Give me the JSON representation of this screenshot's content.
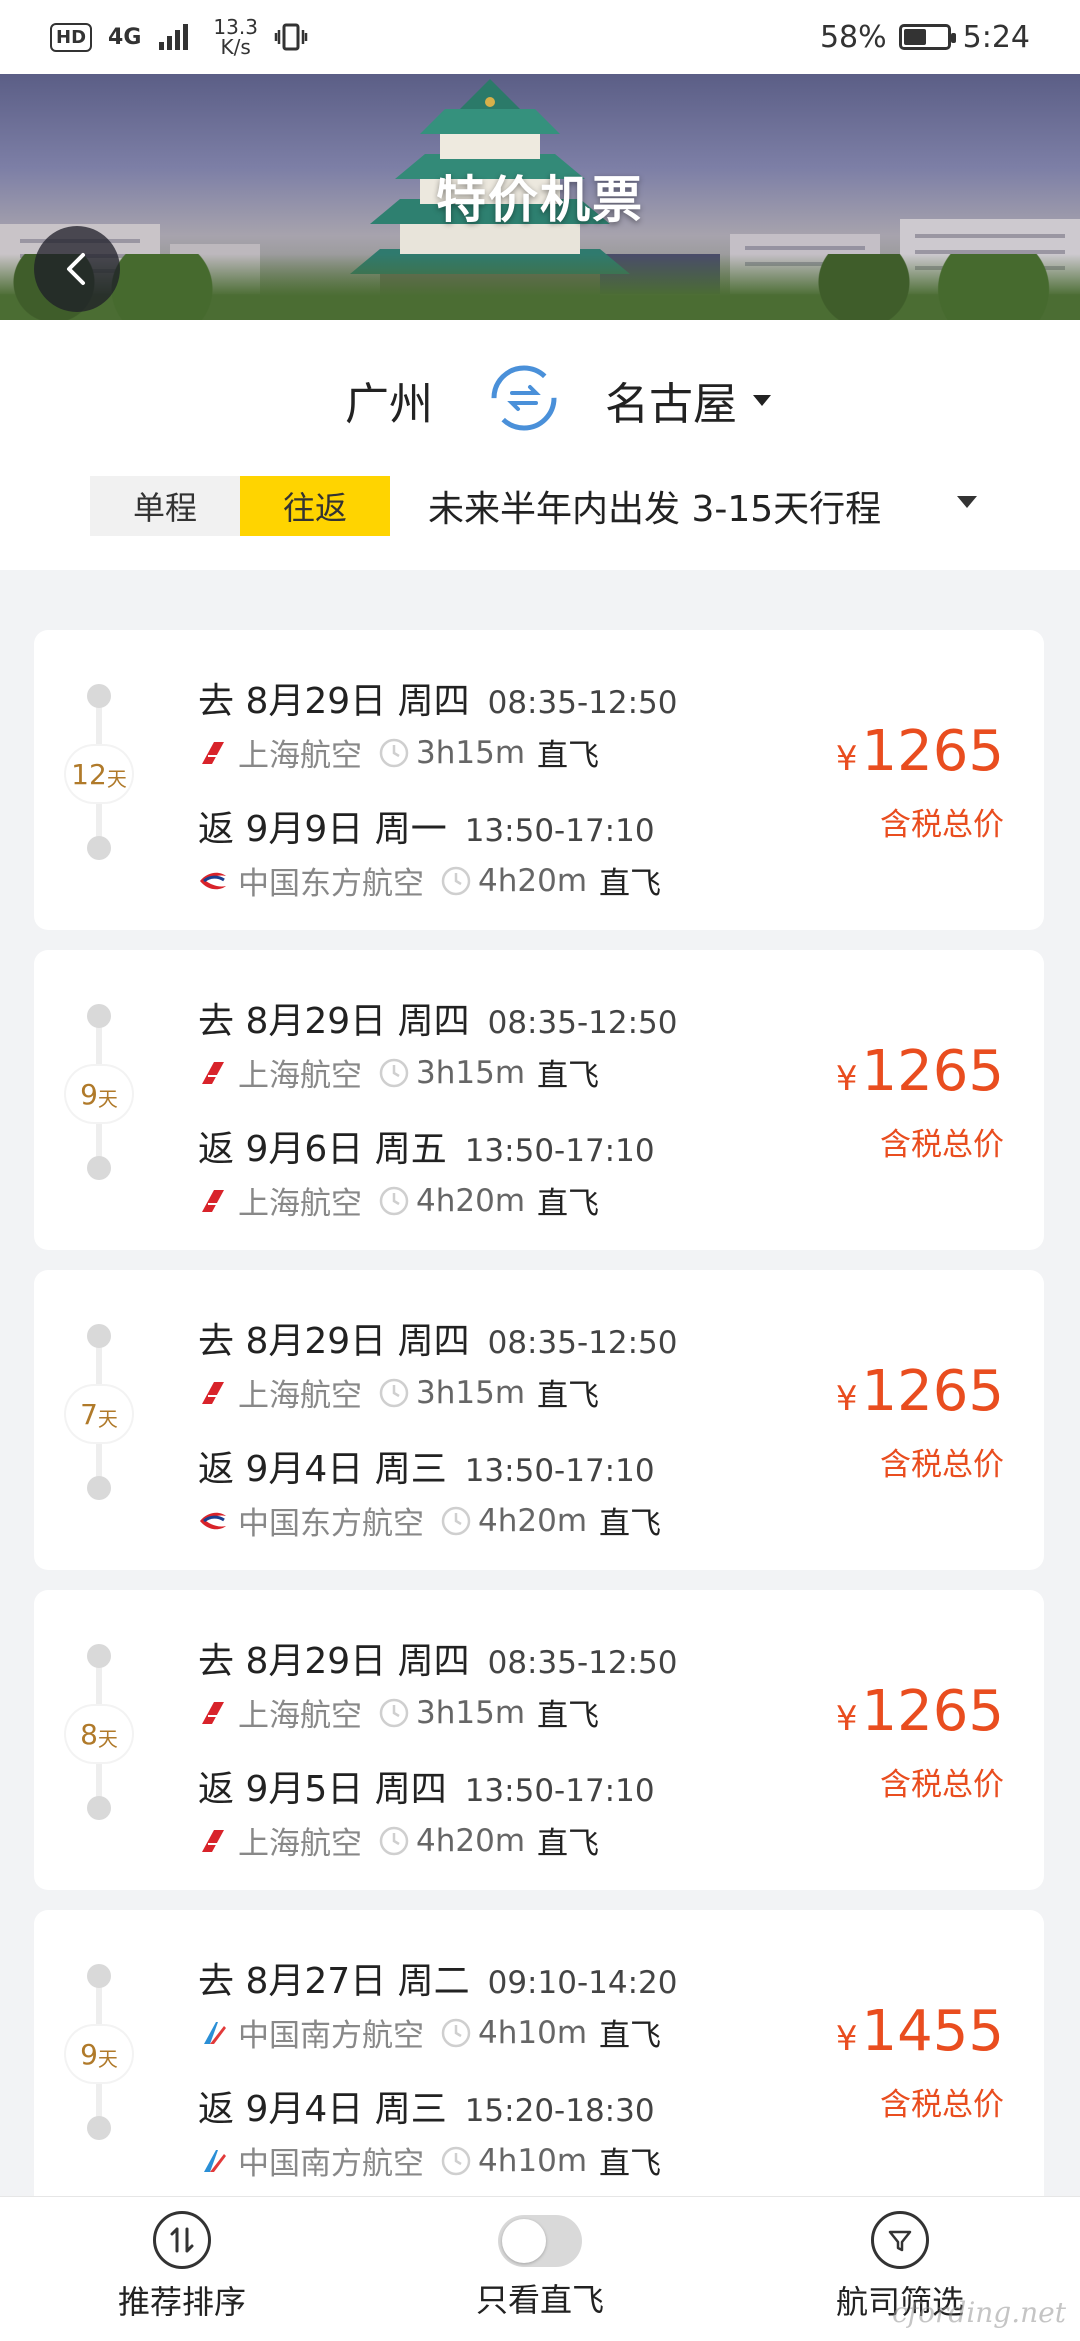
{
  "status_bar": {
    "hd": "HD",
    "signal": "4G",
    "speed_value": "13.3",
    "speed_unit": "K/s",
    "battery_percent": "58%",
    "battery_level": 0.58,
    "time": "5:24"
  },
  "header": {
    "title": "特价机票",
    "from_city": "广州",
    "to_city": "名古屋"
  },
  "trip_type": {
    "options": [
      "单程",
      "往返"
    ],
    "selected": "往返",
    "description": "未来半年内出发 3-15天行程"
  },
  "flights": [
    {
      "days": "12",
      "days_unit": "天",
      "outbound": {
        "date": "去 8月29日 周四",
        "time": "08:35-12:50",
        "airline": "上海航空",
        "airline_icon": "shanghai-airlines-logo",
        "duration": "3h15m",
        "type": "直飞"
      },
      "return": {
        "date": "返 9月9日 周一",
        "time": "13:50-17:10",
        "airline": "中国东方航空",
        "airline_icon": "china-eastern-logo",
        "duration": "4h20m",
        "type": "直飞"
      },
      "currency": "¥",
      "price": "1265",
      "price_note": "含税总价"
    },
    {
      "days": "9",
      "days_unit": "天",
      "outbound": {
        "date": "去 8月29日 周四",
        "time": "08:35-12:50",
        "airline": "上海航空",
        "airline_icon": "shanghai-airlines-logo",
        "duration": "3h15m",
        "type": "直飞"
      },
      "return": {
        "date": "返 9月6日 周五",
        "time": "13:50-17:10",
        "airline": "上海航空",
        "airline_icon": "shanghai-airlines-logo",
        "duration": "4h20m",
        "type": "直飞"
      },
      "currency": "¥",
      "price": "1265",
      "price_note": "含税总价"
    },
    {
      "days": "7",
      "days_unit": "天",
      "outbound": {
        "date": "去 8月29日 周四",
        "time": "08:35-12:50",
        "airline": "上海航空",
        "airline_icon": "shanghai-airlines-logo",
        "duration": "3h15m",
        "type": "直飞"
      },
      "return": {
        "date": "返 9月4日 周三",
        "time": "13:50-17:10",
        "airline": "中国东方航空",
        "airline_icon": "china-eastern-logo",
        "duration": "4h20m",
        "type": "直飞"
      },
      "currency": "¥",
      "price": "1265",
      "price_note": "含税总价"
    },
    {
      "days": "8",
      "days_unit": "天",
      "outbound": {
        "date": "去 8月29日 周四",
        "time": "08:35-12:50",
        "airline": "上海航空",
        "airline_icon": "shanghai-airlines-logo",
        "duration": "3h15m",
        "type": "直飞"
      },
      "return": {
        "date": "返 9月5日 周四",
        "time": "13:50-17:10",
        "airline": "上海航空",
        "airline_icon": "shanghai-airlines-logo",
        "duration": "4h20m",
        "type": "直飞"
      },
      "currency": "¥",
      "price": "1265",
      "price_note": "含税总价"
    },
    {
      "days": "9",
      "days_unit": "天",
      "outbound": {
        "date": "去 8月27日 周二",
        "time": "09:10-14:20",
        "airline": "中国南方航空",
        "airline_icon": "china-southern-logo",
        "duration": "4h10m",
        "type": "直飞"
      },
      "return": {
        "date": "返 9月4日 周三",
        "time": "15:20-18:30",
        "airline": "中国南方航空",
        "airline_icon": "china-southern-logo",
        "duration": "4h10m",
        "type": "直飞"
      },
      "currency": "¥",
      "price": "1455",
      "price_note": "含税总价"
    }
  ],
  "bottom_nav": {
    "sort_label": "推荐排序",
    "direct_label": "只看直飞",
    "direct_only": false,
    "filter_label": "航司筛选"
  },
  "watermark": "cfording.net",
  "colors": {
    "accent_yellow": "#ffd400",
    "price_red": "#e94d1f",
    "days_gold": "#b07a2a",
    "swap_blue": "#4a90d9"
  }
}
